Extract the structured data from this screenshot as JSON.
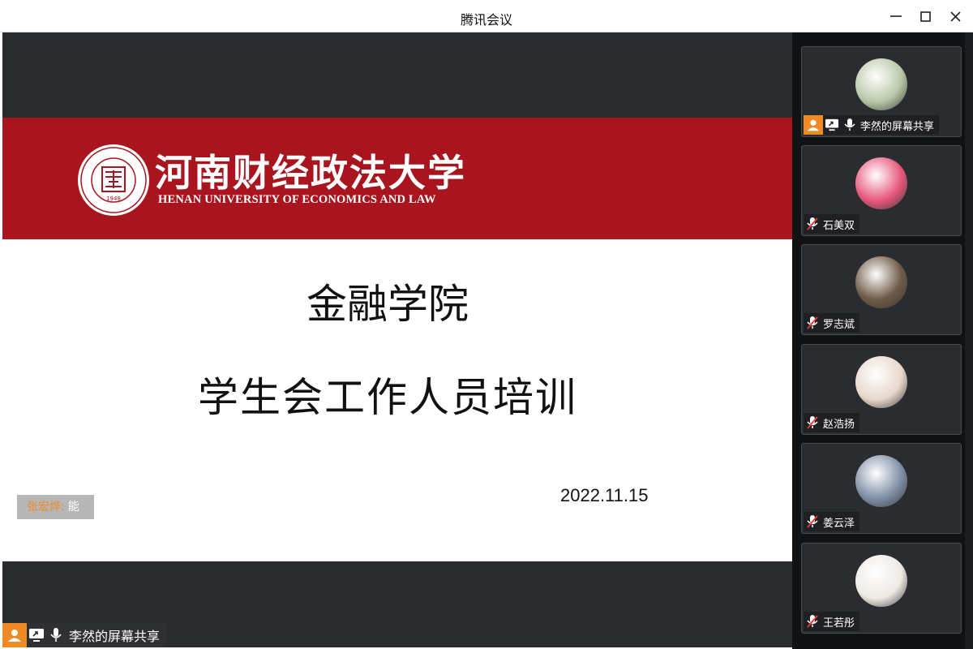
{
  "window": {
    "title": "腾讯会议"
  },
  "slide": {
    "university_name_cn": "河南财经政法大学",
    "university_name_en": "HENAN UNIVERSITY OF ECONOMICS AND LAW",
    "seal_year": "1948",
    "title_line1": "金融学院",
    "title_line2": "学生会工作人员培训",
    "date": "2022.11.15"
  },
  "speaking": {
    "name": "张宏烨:",
    "suffix": "能"
  },
  "stage_label": "李然的屏幕共享",
  "participants": [
    {
      "name": "李然的屏幕共享",
      "mic": "on",
      "sharing": true,
      "host": true,
      "avatar_color": "#b9c8a8"
    },
    {
      "name": "石美双",
      "mic": "muted",
      "sharing": false,
      "host": false,
      "avatar_color": "#e7577a"
    },
    {
      "name": "罗志斌",
      "mic": "muted",
      "sharing": false,
      "host": false,
      "avatar_color": "#6d5a46"
    },
    {
      "name": "赵浩扬",
      "mic": "muted",
      "sharing": false,
      "host": false,
      "avatar_color": "#e8d8cc"
    },
    {
      "name": "姜云泽",
      "mic": "muted",
      "sharing": false,
      "host": false,
      "avatar_color": "#7f8fa6"
    },
    {
      "name": "王若彤",
      "mic": "muted",
      "sharing": false,
      "host": false,
      "avatar_color": "#efe9e4"
    }
  ],
  "colors": {
    "brand_red": "#a8151e",
    "host_orange": "#f08a24",
    "dark_bg": "#2a2c2f"
  }
}
